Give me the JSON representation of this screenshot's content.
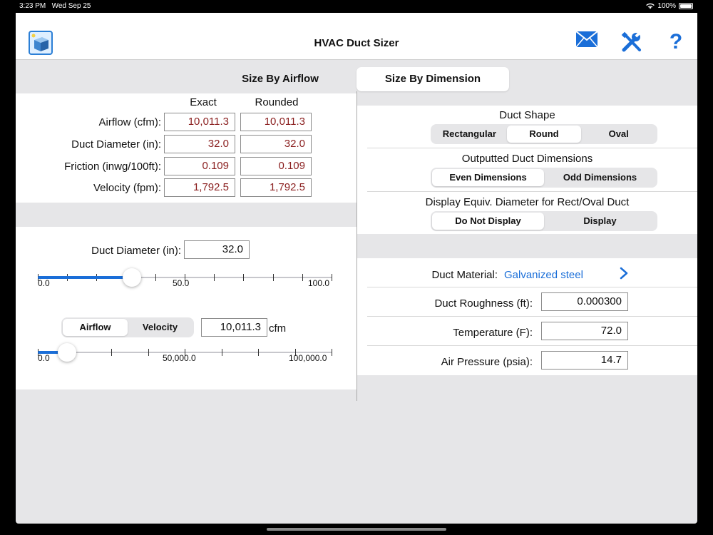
{
  "status": {
    "time": "3:23 PM",
    "date": "Wed Sep 25",
    "battery": "100%"
  },
  "nav": {
    "title": "HVAC Duct Sizer",
    "help_label": "?"
  },
  "mode_tabs": [
    {
      "label": "Size By Airflow",
      "active": false
    },
    {
      "label": "Size By Dimension",
      "active": true
    }
  ],
  "results": {
    "col_exact": "Exact",
    "col_rounded": "Rounded",
    "rows": [
      {
        "label": "Airflow (cfm):",
        "exact": "10,011.3",
        "rounded": "10,011.3"
      },
      {
        "label": "Duct Diameter (in):",
        "exact": "32.0",
        "rounded": "32.0"
      },
      {
        "label": "Friction (inwg/100ft):",
        "exact": "0.109",
        "rounded": "0.109"
      },
      {
        "label": "Velocity (fpm):",
        "exact": "1,792.5",
        "rounded": "1,792.5"
      }
    ]
  },
  "diameter_input": {
    "label": "Duct Diameter (in):",
    "value": "32.0",
    "slider_min_label": "0.0",
    "slider_mid_label": "50.0",
    "slider_max_label": "100.0",
    "slider_fraction": 0.32
  },
  "flow_input": {
    "seg": [
      {
        "label": "Airflow",
        "active": true
      },
      {
        "label": "Velocity",
        "active": false
      }
    ],
    "value": "10,011.3",
    "unit": "cfm",
    "slider_min_label": "0.0",
    "slider_mid_label": "50,000.0",
    "slider_max_label": "100,000.0",
    "slider_fraction": 0.1
  },
  "duct_shape": {
    "title": "Duct Shape",
    "options": [
      {
        "label": "Rectangular",
        "active": false
      },
      {
        "label": "Round",
        "active": true
      },
      {
        "label": "Oval",
        "active": false
      }
    ]
  },
  "output_dims": {
    "title": "Outputted Duct Dimensions",
    "options": [
      {
        "label": "Even Dimensions",
        "active": true
      },
      {
        "label": "Odd Dimensions",
        "active": false
      }
    ]
  },
  "equiv_diameter": {
    "title": "Display Equiv. Diameter for Rect/Oval Duct",
    "options": [
      {
        "label": "Do Not Display",
        "active": true
      },
      {
        "label": "Display",
        "active": false
      }
    ]
  },
  "material": {
    "label": "Duct Material:",
    "value": "Galvanized steel"
  },
  "properties": [
    {
      "label": "Duct Roughness (ft):",
      "value": "0.000300"
    },
    {
      "label": "Temperature (F):",
      "value": "72.0"
    },
    {
      "label": "Air Pressure (psia):",
      "value": "14.7"
    }
  ],
  "colors": {
    "accent": "#1a6ed8",
    "result_text": "#8a1e1e",
    "background": "#e6e6e8"
  }
}
